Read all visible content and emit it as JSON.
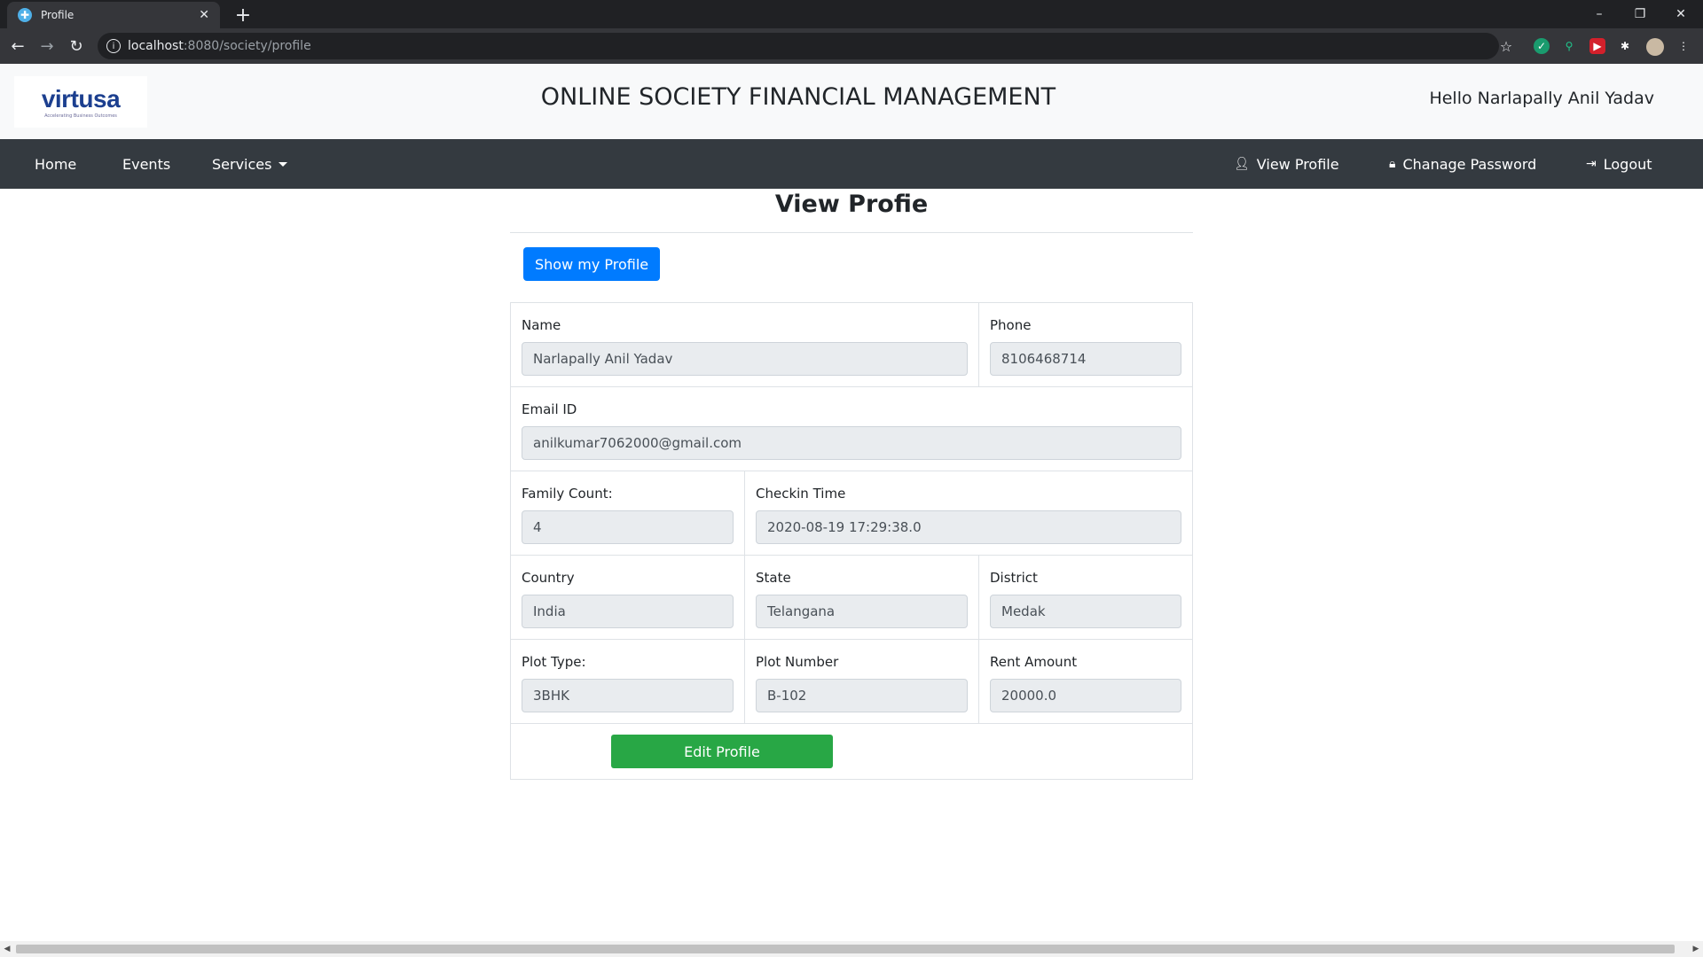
{
  "browser": {
    "tab_title": "Profile",
    "url_host": "localhost",
    "url_path": ":8080/society/profile",
    "tab_close": "✕",
    "new_tab": "+",
    "minimize": "–",
    "restore": "❐",
    "close": "✕"
  },
  "header": {
    "logo_text": "virtusa",
    "logo_tagline": "Accelerating Business Outcomes",
    "title": "ONLINE SOCIETY FINANCIAL MANAGEMENT",
    "greeting": "Hello Narlapally Anil Yadav"
  },
  "nav": {
    "home": "Home",
    "events": "Events",
    "services": "Services",
    "view_profile": "View Profile",
    "change_password": "Chanage Password",
    "logout": "Logout"
  },
  "main": {
    "heading": "View Profie",
    "show_button": "Show my Profile",
    "edit_button": "Edit Profile"
  },
  "profile": {
    "name_label": "Name",
    "name": "Narlapally Anil Yadav",
    "phone_label": "Phone",
    "phone": "8106468714",
    "email_label": "Email ID",
    "email": "anilkumar7062000@gmail.com",
    "family_label": "Family Count:",
    "family": "4",
    "checkin_label": "Checkin Time",
    "checkin": "2020-08-19 17:29:38.0",
    "country_label": "Country",
    "country": "India",
    "state_label": "State",
    "state": "Telangana",
    "district_label": "District",
    "district": "Medak",
    "plot_type_label": "Plot Type:",
    "plot_type": "3BHK",
    "plot_number_label": "Plot Number",
    "plot_number": "B-102",
    "rent_label": "Rent Amount",
    "rent": "20000.0"
  },
  "icons": {
    "back": "back-arrow-icon",
    "forward": "forward-arrow-icon",
    "reload": "reload-icon",
    "user": "user-icon",
    "lock": "lock-icon",
    "logout": "sign-out-icon"
  },
  "colors": {
    "navbar": "#343a40",
    "primary": "#007bff",
    "success": "#28a745"
  }
}
